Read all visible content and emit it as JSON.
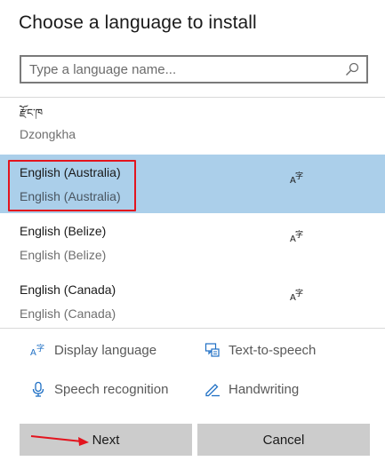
{
  "dialog": {
    "title": "Choose a language to install"
  },
  "search": {
    "placeholder": "Type a language name...",
    "value": ""
  },
  "languages": [
    {
      "native": "རྫོང་ཁ",
      "english": "Dzongkha",
      "selected": false,
      "features": []
    },
    {
      "native": "English (Australia)",
      "english": "English (Australia)",
      "selected": true,
      "features": [
        "display-language-icon"
      ]
    },
    {
      "native": "English (Belize)",
      "english": "English (Belize)",
      "selected": false,
      "features": [
        "display-language-icon"
      ]
    },
    {
      "native": "English (Canada)",
      "english": "English (Canada)",
      "selected": false,
      "features": [
        "display-language-icon"
      ]
    }
  ],
  "legend": {
    "display_language": "Display language",
    "text_to_speech": "Text-to-speech",
    "speech_recognition": "Speech recognition",
    "handwriting": "Handwriting"
  },
  "buttons": {
    "next": "Next",
    "cancel": "Cancel"
  },
  "colors": {
    "selected_bg": "#abcfea",
    "highlight": "#e3141e",
    "icon_blue": "#1e6fc4",
    "button_bg": "#cccccc"
  }
}
